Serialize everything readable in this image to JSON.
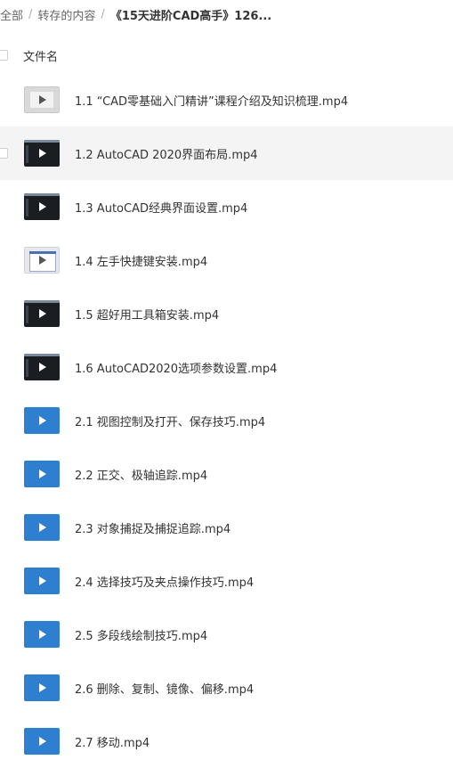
{
  "breadcrumb": {
    "items": [
      "全部",
      "转存的内容"
    ],
    "current": "《15天进阶CAD高手》126..."
  },
  "header": {
    "column_label": "文件名"
  },
  "files": [
    {
      "name": "1.1 “CAD零基础入门精讲”课程介绍及知识梳理.mp4",
      "thumb": "light"
    },
    {
      "name": "1.2 AutoCAD 2020界面布局.mp4",
      "thumb": "dark",
      "hovered": true
    },
    {
      "name": "1.3 AutoCAD经典界面设置.mp4",
      "thumb": "dark"
    },
    {
      "name": "1.4 左手快捷键安装.mp4",
      "thumb": "panel"
    },
    {
      "name": "1.5 超好用工具箱安装.mp4",
      "thumb": "dark"
    },
    {
      "name": "1.6 AutoCAD2020选项参数设置.mp4",
      "thumb": "dark"
    },
    {
      "name": "2.1 视图控制及打开、保存技巧.mp4",
      "thumb": "blue"
    },
    {
      "name": "2.2 正交、极轴追踪.mp4",
      "thumb": "blue"
    },
    {
      "name": "2.3 对象捕捉及捕捉追踪.mp4",
      "thumb": "blue"
    },
    {
      "name": "2.4 选择技巧及夹点操作技巧.mp4",
      "thumb": "blue"
    },
    {
      "name": "2.5 多段线绘制技巧.mp4",
      "thumb": "blue"
    },
    {
      "name": "2.6 删除、复制、镜像、偏移.mp4",
      "thumb": "blue"
    },
    {
      "name": "2.7 移动.mp4",
      "thumb": "blue"
    }
  ],
  "colors": {
    "play_blue": "#2f7fd0",
    "hover_bg": "#f4f4f4"
  }
}
